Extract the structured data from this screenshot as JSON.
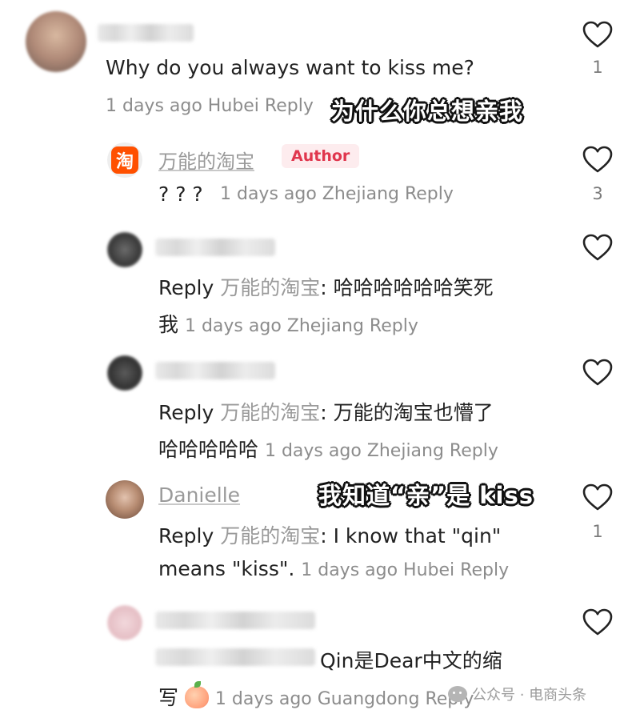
{
  "comments": [
    {
      "text": "Why do you always want to kiss me?",
      "meta": "1 days ago Hubei Reply",
      "likes": "1"
    },
    {
      "username": "万能的淘宝",
      "badge": "Author",
      "text": "? ? ?",
      "meta": "1 days ago Zhejiang Reply",
      "likes": "3"
    },
    {
      "reply_prefix": "Reply",
      "reply_to": "万能的淘宝",
      "text_line1": ": 哈哈哈哈哈哈笑死",
      "text_line2": "我",
      "meta": "1 days ago Zhejiang Reply"
    },
    {
      "reply_prefix": "Reply",
      "reply_to": "万能的淘宝",
      "text_line1": ": 万能的淘宝也懵了",
      "text_line2": "哈哈哈哈哈",
      "meta": "1 days ago Zhejiang Reply"
    },
    {
      "username": "Danielle",
      "reply_prefix": "Reply",
      "reply_to": "万能的淘宝",
      "text_line1": ": I know that \"qin\"",
      "text_line2": "means \"kiss\".",
      "meta": "1 days ago Hubei Reply",
      "likes": "1"
    },
    {
      "text_line1": "Qin是Dear中文的缩",
      "text_line2": "写",
      "meta": "1 days ago Guangdong Reply"
    }
  ],
  "overlays": {
    "caption1": "为什么你总想亲我",
    "caption2": "我知道“亲”是 kiss"
  },
  "taobao_logo_char": "淘",
  "watermark": "公众号 · 电商头条",
  "icons": {
    "like": "heart-outline-icon",
    "emoji": "peach-emoji-icon",
    "wechat": "wechat-logo-icon"
  },
  "colors": {
    "author_badge_bg": "#fdecee",
    "author_badge_text": "#e0364d",
    "taobao_orange": "#ff5000",
    "meta_gray": "#8c8c8c"
  }
}
